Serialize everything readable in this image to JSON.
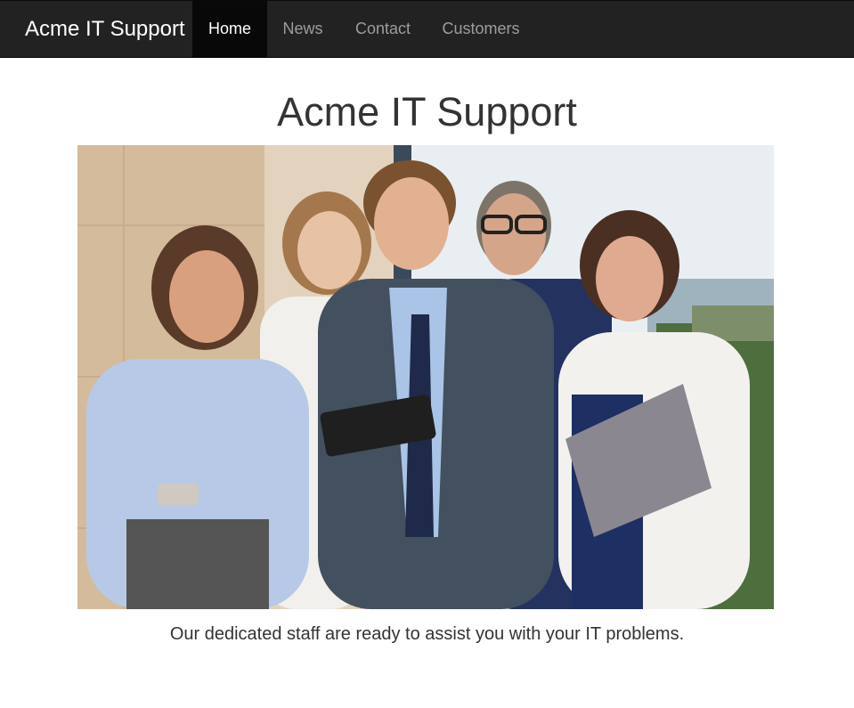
{
  "navbar": {
    "brand": "Acme IT Support",
    "items": [
      {
        "label": "Home",
        "active": true
      },
      {
        "label": "News",
        "active": false
      },
      {
        "label": "Contact",
        "active": false
      },
      {
        "label": "Customers",
        "active": false
      }
    ]
  },
  "main": {
    "title": "Acme IT Support",
    "caption": "Our dedicated staff are ready to assist you with your IT problems."
  },
  "colors": {
    "navbar_bg": "#222222",
    "nav_active_bg": "#080808",
    "nav_text": "#9d9d9d",
    "text": "#333333"
  }
}
